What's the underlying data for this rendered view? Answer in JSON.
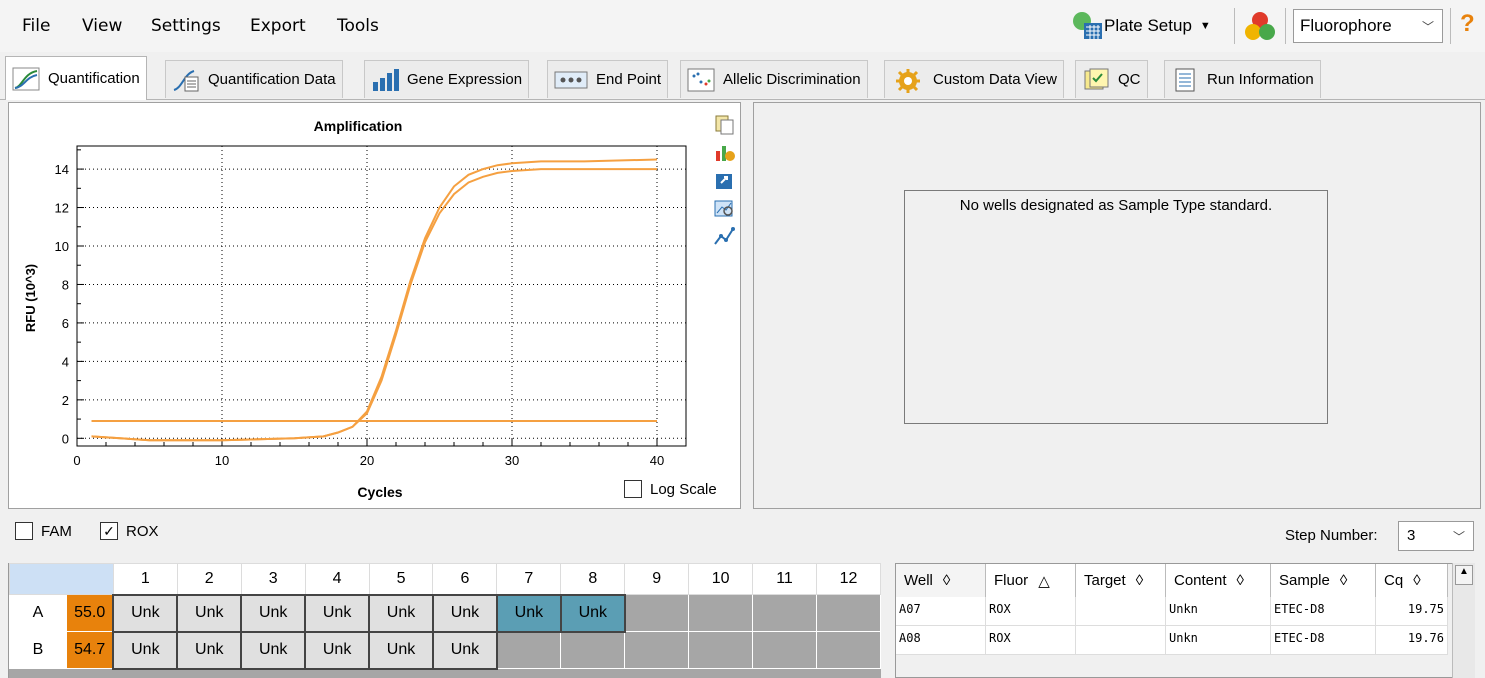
{
  "menu": [
    "File",
    "View",
    "Settings",
    "Export",
    "Tools"
  ],
  "toolbar": {
    "plate_setup": "Plate Setup",
    "fluorophore": "Fluorophore",
    "help": "?"
  },
  "tabs": [
    "Quantification",
    "Quantification Data",
    "Gene Expression",
    "End Point",
    "Allelic Discrimination",
    "Custom Data View",
    "QC",
    "Run Information"
  ],
  "chart_data": {
    "type": "line",
    "title": "Amplification",
    "xlabel": "Cycles",
    "ylabel": "RFU (10^3)",
    "xlim": [
      0,
      42
    ],
    "ylim": [
      -0.4,
      15.2
    ],
    "xticks": [
      0,
      10,
      20,
      30,
      40
    ],
    "yticks": [
      0,
      2,
      4,
      6,
      8,
      10,
      12,
      14
    ],
    "grid": "dotted",
    "series": [
      {
        "color": "#f5a041",
        "x": [
          1,
          5,
          10,
          15,
          17,
          18,
          19,
          20,
          21,
          22,
          23,
          24,
          25,
          26,
          27,
          28,
          29,
          30,
          32,
          35,
          40
        ],
        "y": [
          0.1,
          -0.1,
          -0.1,
          0,
          0.1,
          0.3,
          0.6,
          1.4,
          3.2,
          5.6,
          8.2,
          10.4,
          12.0,
          13.1,
          13.7,
          14.0,
          14.2,
          14.3,
          14.4,
          14.4,
          14.5
        ]
      },
      {
        "color": "#f5a041",
        "x": [
          1,
          5,
          10,
          15,
          17,
          18,
          19,
          20,
          21,
          22,
          23,
          24,
          25,
          26,
          27,
          28,
          29,
          30,
          32,
          35,
          40
        ],
        "y": [
          0.1,
          -0.1,
          -0.1,
          0,
          0.1,
          0.3,
          0.6,
          1.3,
          3.0,
          5.4,
          8.0,
          10.2,
          11.7,
          12.7,
          13.3,
          13.6,
          13.8,
          13.9,
          14.0,
          14.0,
          14.0
        ]
      },
      {
        "color": "#f5a041",
        "x": [
          1,
          40
        ],
        "y": [
          0.9,
          0.9
        ]
      }
    ]
  },
  "log_scale_label": "Log Scale",
  "no_wells_msg": "No wells designated as Sample Type standard.",
  "filters": {
    "fam": "FAM",
    "rox": "ROX"
  },
  "step": {
    "label": "Step Number:",
    "value": "3"
  },
  "plate": {
    "columns": [
      "1",
      "2",
      "3",
      "4",
      "5",
      "6",
      "7",
      "8",
      "9",
      "10",
      "11",
      "12"
    ],
    "rows": [
      {
        "label": "A",
        "temp": "55.0",
        "wells": [
          "Unk",
          "Unk",
          "Unk",
          "Unk",
          "Unk",
          "Unk",
          "Unk",
          "Unk",
          "",
          "",
          "",
          ""
        ]
      },
      {
        "label": "B",
        "temp": "54.7",
        "wells": [
          "Unk",
          "Unk",
          "Unk",
          "Unk",
          "Unk",
          "Unk",
          "",
          "",
          "",
          "",
          "",
          ""
        ]
      }
    ]
  },
  "results": {
    "headers": [
      "Well",
      "Fluor",
      "Target",
      "Content",
      "Sample",
      "Cq"
    ],
    "rows": [
      [
        "A07",
        "ROX",
        "",
        "Unkn",
        "ETEC-D8",
        "19.75"
      ],
      [
        "A08",
        "ROX",
        "",
        "Unkn",
        "ETEC-D8",
        "19.76"
      ]
    ]
  }
}
